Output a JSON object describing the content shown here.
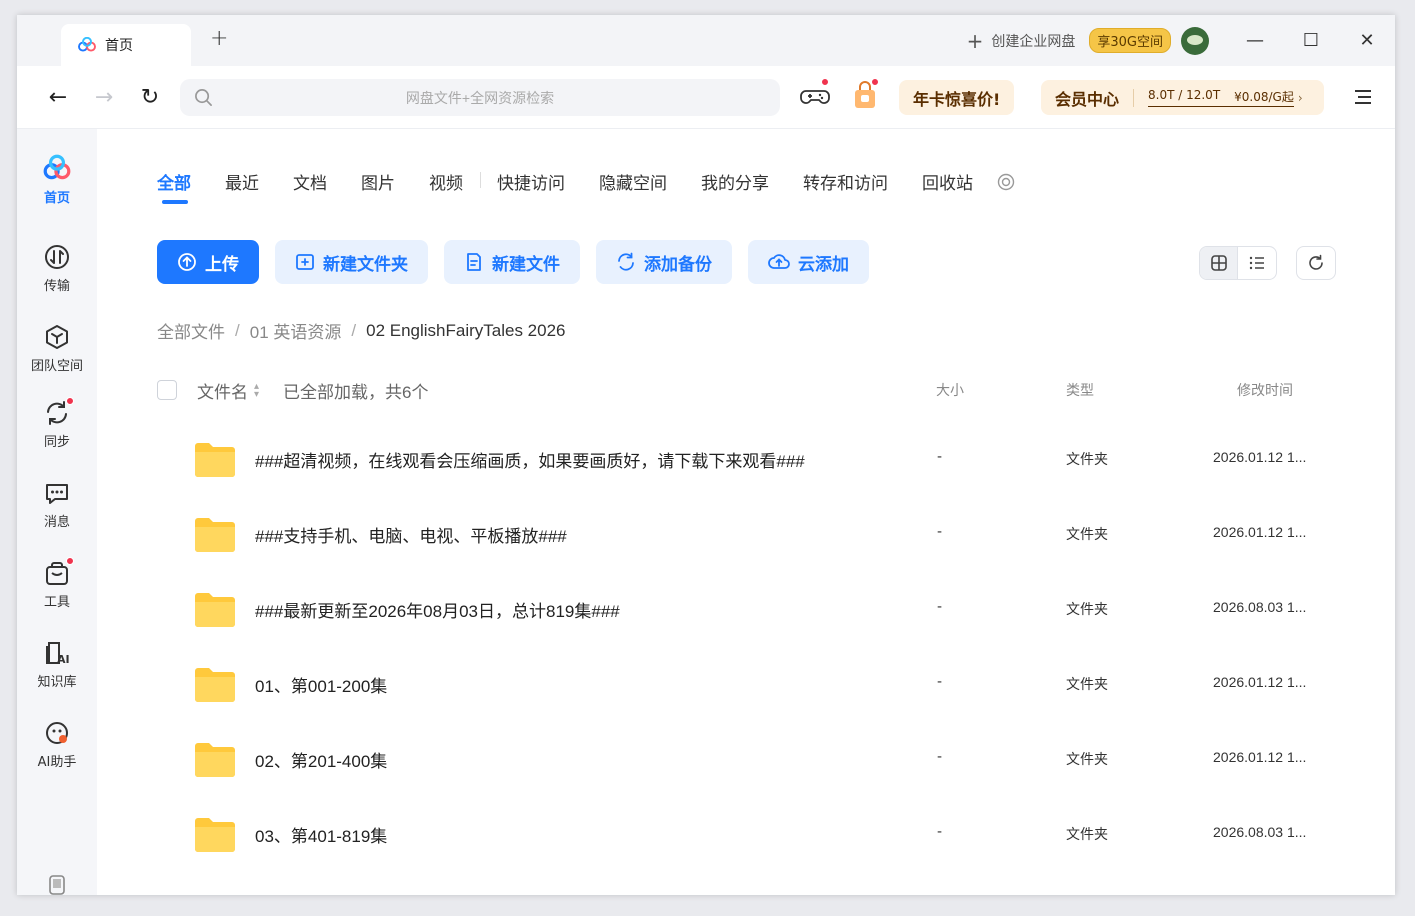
{
  "titlebar": {
    "tab_title": "首页",
    "new_tab": "+",
    "enterprise_label": "创建企业网盘",
    "space_badge": "享30G空间",
    "minimize": "—",
    "maximize": "☐",
    "close": "✕"
  },
  "toolbar": {
    "back": "←",
    "forward": "→",
    "reload": "↻",
    "search_placeholder": "网盘文件+全网资源检索",
    "promo_label": "年卡惊喜价!",
    "vip_label": "会员中心",
    "vip_quota": "8.0T / 12.0T",
    "vip_price": "¥0.08/G起",
    "vip_arrow": "›"
  },
  "sidebar": {
    "items": [
      {
        "label": "首页",
        "icon": "home-logo-icon",
        "active": true
      },
      {
        "label": "传输",
        "icon": "transfer-icon",
        "active": false
      },
      {
        "label": "团队空间",
        "icon": "team-space-icon",
        "active": false
      },
      {
        "label": "同步",
        "icon": "sync-icon",
        "active": false,
        "dot": true
      },
      {
        "label": "消息",
        "icon": "message-icon",
        "active": false
      },
      {
        "label": "工具",
        "icon": "tools-icon",
        "active": false,
        "dot": true
      },
      {
        "label": "知识库",
        "icon": "knowledge-base-icon",
        "active": false
      },
      {
        "label": "AI助手",
        "icon": "ai-assistant-icon",
        "active": false
      }
    ]
  },
  "categories": [
    "全部",
    "最近",
    "文档",
    "图片",
    "视频",
    "快捷访问",
    "隐藏空间",
    "我的分享",
    "转存和访问",
    "回收站"
  ],
  "actions": {
    "upload": "上传",
    "new_folder": "新建文件夹",
    "new_file": "新建文件",
    "add_backup": "添加备份",
    "cloud_add": "云添加"
  },
  "breadcrumb": {
    "root": "全部文件",
    "level1": "01 英语资源",
    "current": "02 EnglishFairyTales 2026",
    "separator": "/"
  },
  "table": {
    "col_name": "文件名",
    "loaded_status": "已全部加载，共6个",
    "col_size": "大小",
    "col_type": "类型",
    "col_time": "修改时间",
    "rows": [
      {
        "name": "###超清视频，在线观看会压缩画质，如果要画质好，请下载下来观看###",
        "size": "-",
        "type": "文件夹",
        "time": "2026.01.12 1..."
      },
      {
        "name": "###支持手机、电脑、电视、平板播放###",
        "size": "-",
        "type": "文件夹",
        "time": "2026.01.12 1..."
      },
      {
        "name": "###最新更新至2026年08月03日，总计819集###",
        "size": "-",
        "type": "文件夹",
        "time": "2026.08.03 1..."
      },
      {
        "name": "01、第001-200集",
        "size": "-",
        "type": "文件夹",
        "time": "2026.01.12 1..."
      },
      {
        "name": "02、第201-400集",
        "size": "-",
        "type": "文件夹",
        "time": "2026.01.12 1..."
      },
      {
        "name": "03、第401-819集",
        "size": "-",
        "type": "文件夹",
        "time": "2026.08.03 1..."
      }
    ]
  },
  "colors": {
    "accent": "#1e78ff",
    "folder": "#ffc93c",
    "promo_bg": "#fdf1e0",
    "badge": "#f5c547"
  }
}
